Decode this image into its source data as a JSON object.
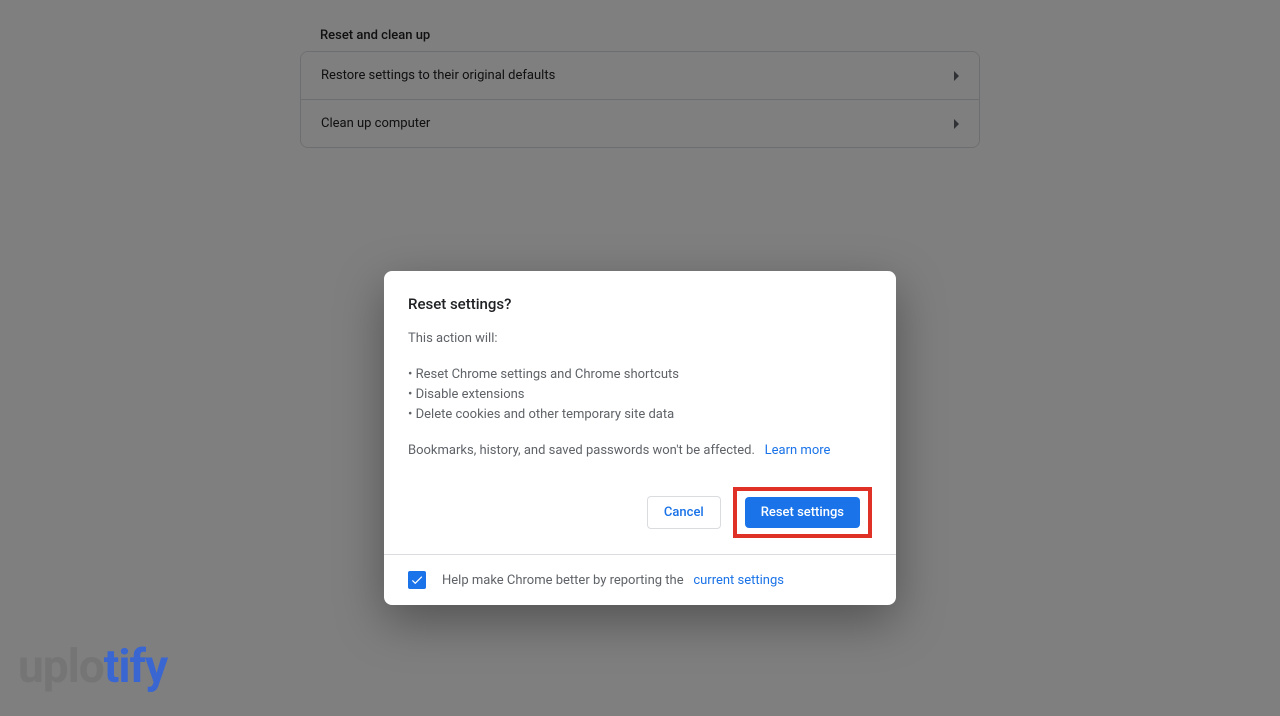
{
  "section": {
    "title": "Reset and clean up",
    "items": [
      {
        "label": "Restore settings to their original defaults"
      },
      {
        "label": "Clean up computer"
      }
    ]
  },
  "dialog": {
    "title": "Reset settings?",
    "intro": "This action will:",
    "bullets": [
      "• Reset Chrome settings and Chrome shortcuts",
      "• Disable extensions",
      "• Delete cookies and other temporary site data"
    ],
    "note": "Bookmarks, history, and saved passwords won't be affected.",
    "learn_more": "Learn more",
    "cancel_label": "Cancel",
    "confirm_label": "Reset settings",
    "footer": {
      "text": "Help make Chrome better by reporting the",
      "link": "current settings",
      "checked": true
    }
  },
  "watermark": {
    "part1": "uplo",
    "part2": "tify"
  }
}
